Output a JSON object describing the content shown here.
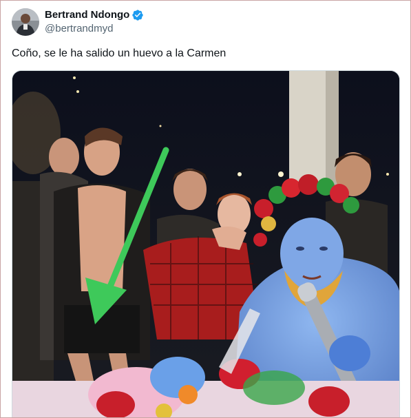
{
  "tweet": {
    "author": {
      "display_name": "Bertrand Ndongo",
      "handle": "@bertrandmyd",
      "verified": true,
      "avatar_icon": "profile-avatar-icon",
      "verified_icon": "verified-badge-icon",
      "verified_color": "#1d9bf0"
    },
    "text": "Coño, se le ha salido un huevo a la Carmen",
    "media": {
      "type": "photo",
      "annotation_icon": "green-arrow-icon",
      "annotation_color": "#3ec95a"
    }
  },
  "colors": {
    "text_primary": "#0f1419",
    "text_secondary": "#536471",
    "border": "#c9a4a4"
  }
}
